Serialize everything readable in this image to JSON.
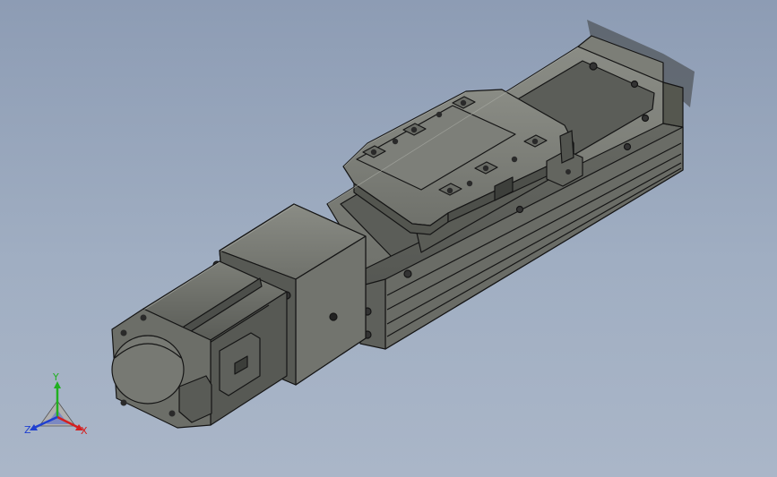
{
  "viewport": {
    "background_top": "#8d9cb4",
    "background_bottom": "#aab6c8",
    "body_color": "#74766f",
    "body_dark": "#4a4c48",
    "edge_color": "#151515"
  },
  "model": {
    "parts": [
      "servo-motor",
      "motor-adapter-flange",
      "linear-actuator-body",
      "carriage-plate",
      "end-cap"
    ]
  },
  "triad": {
    "x_label": "X",
    "y_label": "Y",
    "z_label": "Z",
    "x_color": "#d42020",
    "y_color": "#20b020",
    "z_color": "#2040d0"
  }
}
